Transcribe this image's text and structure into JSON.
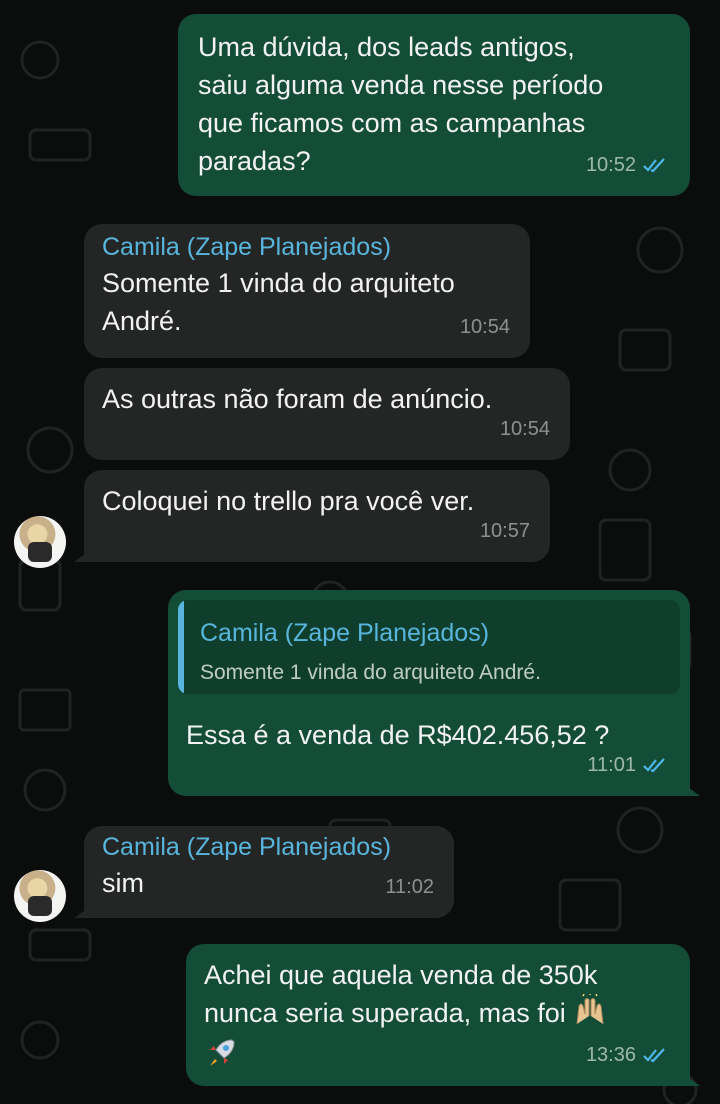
{
  "messages": [
    {
      "text_lines": [
        "Uma dúvida, dos leads antigos,",
        "saiu alguma venda nesse período",
        "que ficamos com as campanhas",
        "paradas?"
      ],
      "time": "10:52"
    },
    {
      "sender": "Camila (Zape Planejados)",
      "text_lines": [
        "Somente 1 vinda do arquiteto",
        "André."
      ],
      "time": "10:54"
    },
    {
      "text": "As outras não foram de anúncio.",
      "time": "10:54"
    },
    {
      "text": "Coloquei no trello pra você ver.",
      "time": "10:57"
    },
    {
      "quote_sender": "Camila (Zape Planejados)",
      "quote_text": "Somente 1 vinda do arquiteto André.",
      "text": "Essa é a venda de R$402.456,52 ?",
      "time": "11:01"
    },
    {
      "sender": "Camila (Zape Planejados)",
      "text": "sim",
      "time": "11:02"
    },
    {
      "text_lines": [
        "Achei que aquela venda de 350k",
        "nunca seria superada, mas foi"
      ],
      "emoji_1": "raising-hands-emoji",
      "emoji_2": "rocket-emoji",
      "time": "13:36"
    }
  ],
  "colors": {
    "outgoing_bubble": "#144d37",
    "incoming_bubble": "#242626",
    "sender_name": "#58b6dd",
    "read_ticks": "#4fb6ec"
  }
}
